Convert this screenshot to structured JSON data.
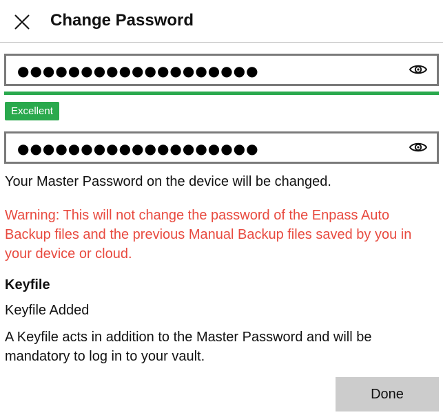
{
  "header": {
    "title": "Change Password",
    "close_icon": "close-icon"
  },
  "new_password": {
    "value": "●●●●●●●●●●●●●●●●●●●",
    "toggle_icon": "eye-icon"
  },
  "strength": {
    "level": 1.0,
    "label": "Excellent",
    "color": "#2aa94d"
  },
  "confirm_password": {
    "value": "●●●●●●●●●●●●●●●●●●●",
    "toggle_icon": "eye-icon"
  },
  "info_text": "Your Master Password on the device will be changed.",
  "warning_text": "Warning: This will not change the password of the Enpass Auto Backup files and the previous Manual Backup files saved by you in your device or cloud.",
  "warning_color": "#e84a3f",
  "keyfile": {
    "heading": "Keyfile",
    "status": "Keyfile Added",
    "description": "A Keyfile acts in addition to the Master Password and will be mandatory to log in to your vault."
  },
  "done_label": "Done"
}
